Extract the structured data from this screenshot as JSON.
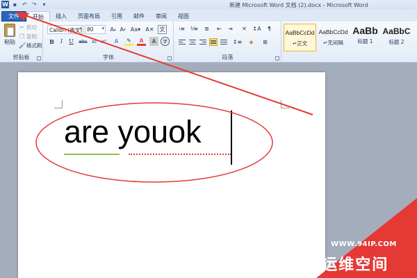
{
  "title_bar": {
    "title": "新建 Microsoft Word 文档 (2).docx - Microsoft Word",
    "quick_access": [
      "word-logo",
      "save-icon",
      "undo-icon",
      "redo-icon",
      "customize-icon"
    ]
  },
  "tabs": [
    {
      "label": "文件",
      "state": "file"
    },
    {
      "label": "开始",
      "state": "active"
    },
    {
      "label": "插入",
      "state": ""
    },
    {
      "label": "页面布局",
      "state": ""
    },
    {
      "label": "引用",
      "state": ""
    },
    {
      "label": "邮件",
      "state": ""
    },
    {
      "label": "审阅",
      "state": ""
    },
    {
      "label": "视图",
      "state": ""
    }
  ],
  "clipboard": {
    "paste_label": "粘贴",
    "cut_label": "剪切",
    "copy_label": "复制",
    "format_painter_label": "格式刷",
    "group_label": "剪贴板"
  },
  "font": {
    "font_name": "Calibri (西文)",
    "font_size": "80",
    "group_label": "字体"
  },
  "paragraph": {
    "group_label": "段落"
  },
  "styles": {
    "items": [
      {
        "sample": "AaBbCcDd",
        "name": "↵正文",
        "selected": true
      },
      {
        "sample": "AaBbCcDd",
        "name": "↵无间隔",
        "selected": false
      },
      {
        "sample": "AaBb",
        "name": "标题 1",
        "selected": false
      },
      {
        "sample": "AaBbC",
        "name": "标题 2",
        "selected": false
      }
    ]
  },
  "document": {
    "text": "are youok"
  },
  "watermark": {
    "url": "WWW.94IP.COM",
    "brand": "IT运维空间"
  },
  "colors": {
    "file_tab": "#2a63b9",
    "annotation": "#e53935"
  }
}
